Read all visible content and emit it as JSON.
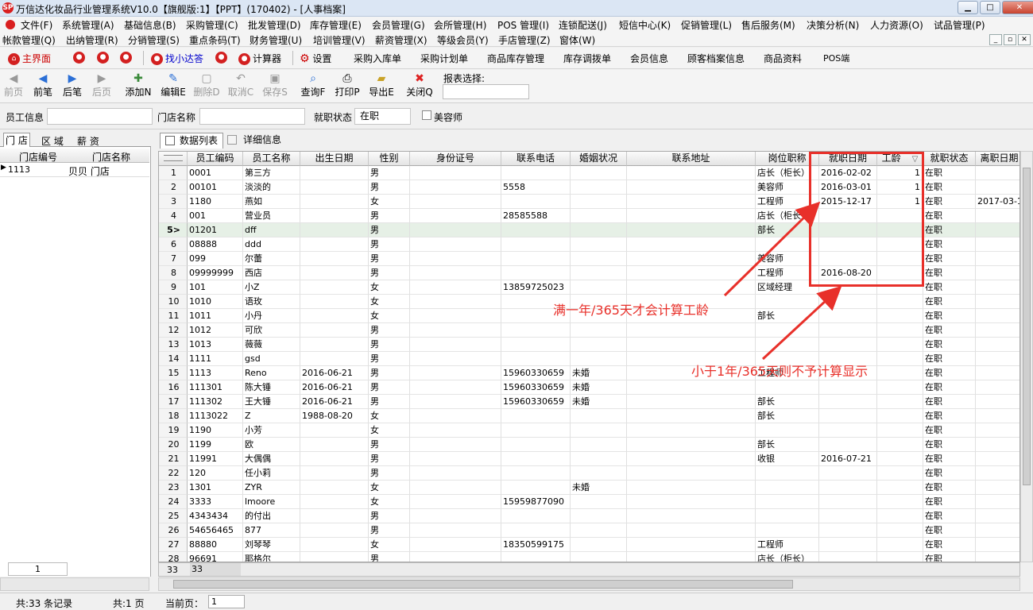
{
  "window": {
    "title": "万信达化妆品行业管理系统V10.0【旗舰版:1】【PPT】(170402) - [人事档案]",
    "logo": "SP",
    "min": "▁",
    "max": "□",
    "close": "✕"
  },
  "menu1": [
    "文件(F)",
    "系统管理(A)",
    "基础信息(B)",
    "采购管理(C)",
    "批发管理(D)",
    "库存管理(E)",
    "会员管理(G)",
    "会所管理(H)",
    "POS 管理(I)",
    "连锁配送(J)",
    "短信中心(K)",
    "促销管理(L)",
    "售后服务(M)",
    "决策分析(N)",
    "人力资源(O)",
    "试品管理(P)"
  ],
  "menu2": [
    "帐款管理(Q)",
    "出纳管理(R)",
    "分销管理(S)",
    "重点条码(T)",
    "财务管理(U)",
    "培训管理(V)",
    "薪资管理(X)",
    "等级会员(Y)",
    "手店管理(Z)",
    "窗体(W)"
  ],
  "mdi": [
    "_",
    "▫",
    "✕"
  ],
  "quickbar": {
    "home": "主界面",
    "find": "找小达答",
    "calculator": "计算器",
    "settings": "设置",
    "links": [
      "采购入库单",
      "采购计划单",
      "商品库存管理",
      "库存调拨单",
      "会员信息",
      "顾客档案信息",
      "商品资料",
      "POS端"
    ]
  },
  "toolbar": {
    "first": "前页",
    "prev": "前笔",
    "next": "后笔",
    "last": "后页",
    "add": "添加N",
    "edit": "编辑E",
    "delete": "删除D",
    "cancel": "取消C",
    "save": "保存S",
    "query": "查询F",
    "print": "打印P",
    "export": "导出E",
    "close": "关闭Q",
    "report_label": "报表选择:"
  },
  "filter": {
    "employee_label": "员工信息",
    "store_label": "门店名称",
    "status_label": "就职状态",
    "status_value": "在职",
    "beautician_label": "美容师"
  },
  "left": {
    "tabs": [
      "门 店",
      "区 域",
      "薪 资"
    ],
    "col_code": "门店编号",
    "col_name": "门店名称",
    "row_code": "1113",
    "row_name": "贝贝 门店",
    "footer_count": "1"
  },
  "right": {
    "tab_list": "数据列表",
    "tab_detail": "详细信息"
  },
  "grid": {
    "columns": [
      "员工编码",
      "员工名称",
      "出生日期",
      "性别",
      "身份证号",
      "联系电话",
      "婚姻状况",
      "联系地址",
      "岗位职称",
      "就职日期",
      "工龄",
      "就职状态",
      "离职日期"
    ],
    "sort_icon": "▽",
    "selected_index": 4,
    "rows": [
      [
        "1",
        "0001",
        "第三方",
        "",
        "男",
        "",
        "",
        "",
        "",
        "店长（柜长）",
        "2016-02-02",
        "1",
        "在职",
        ""
      ],
      [
        "2",
        "00101",
        "淡淡的",
        "",
        "男",
        "",
        "5558",
        "",
        "",
        "美容师",
        "2016-03-01",
        "1",
        "在职",
        ""
      ],
      [
        "3",
        "1180",
        "燕如",
        "",
        "女",
        "",
        "",
        "",
        "",
        "工程师",
        "2015-12-17",
        "1",
        "在职",
        "2017-03-1"
      ],
      [
        "4",
        "001",
        "营业员",
        "",
        "男",
        "",
        "28585588",
        "",
        "",
        "店长（柜长）",
        "",
        "",
        "在职",
        ""
      ],
      [
        "5>",
        "01201",
        "dff",
        "",
        "男",
        "",
        "",
        "",
        "",
        "部长",
        "",
        "",
        "在职",
        ""
      ],
      [
        "6",
        "08888",
        "ddd",
        "",
        "男",
        "",
        "",
        "",
        "",
        "",
        "",
        "",
        "在职",
        ""
      ],
      [
        "7",
        "099",
        "尔蕾",
        "",
        "男",
        "",
        "",
        "",
        "",
        "美容师",
        "",
        "",
        "在职",
        ""
      ],
      [
        "8",
        "09999999",
        "西店",
        "",
        "男",
        "",
        "",
        "",
        "",
        "工程师",
        "2016-08-20",
        "",
        "在职",
        ""
      ],
      [
        "9",
        "101",
        "小Z",
        "",
        "女",
        "",
        "13859725023",
        "",
        "",
        "区域经理",
        "",
        "",
        "在职",
        ""
      ],
      [
        "10",
        "1010",
        "语玫",
        "",
        "女",
        "",
        "",
        "",
        "",
        "",
        "",
        "",
        "在职",
        ""
      ],
      [
        "11",
        "1011",
        "小丹",
        "",
        "女",
        "",
        "",
        "",
        "",
        "部长",
        "",
        "",
        "在职",
        ""
      ],
      [
        "12",
        "1012",
        "可欣",
        "",
        "男",
        "",
        "",
        "",
        "",
        "",
        "",
        "",
        "在职",
        ""
      ],
      [
        "13",
        "1013",
        "薇薇",
        "",
        "男",
        "",
        "",
        "",
        "",
        "",
        "",
        "",
        "在职",
        ""
      ],
      [
        "14",
        "1111",
        "gsd",
        "",
        "男",
        "",
        "",
        "",
        "",
        "",
        "",
        "",
        "在职",
        ""
      ],
      [
        "15",
        "1113",
        "Reno",
        "2016-06-21",
        "男",
        "",
        "15960330659",
        "未婚",
        "",
        "工程师",
        "",
        "",
        "在职",
        ""
      ],
      [
        "16",
        "111301",
        "陈大锤",
        "2016-06-21",
        "男",
        "",
        "15960330659",
        "未婚",
        "",
        "",
        "",
        "",
        "在职",
        ""
      ],
      [
        "17",
        "111302",
        "王大锤",
        "2016-06-21",
        "男",
        "",
        "15960330659",
        "未婚",
        "",
        "部长",
        "",
        "",
        "在职",
        ""
      ],
      [
        "18",
        "1113022",
        "Z",
        "1988-08-20",
        "女",
        "",
        "",
        "",
        "",
        "部长",
        "",
        "",
        "在职",
        ""
      ],
      [
        "19",
        "1190",
        "小芳",
        "",
        "女",
        "",
        "",
        "",
        "",
        "",
        "",
        "",
        "在职",
        ""
      ],
      [
        "20",
        "1199",
        "欧",
        "",
        "男",
        "",
        "",
        "",
        "",
        "部长",
        "",
        "",
        "在职",
        ""
      ],
      [
        "21",
        "11991",
        "大偶偶",
        "",
        "男",
        "",
        "",
        "",
        "",
        "收银",
        "2016-07-21",
        "",
        "在职",
        ""
      ],
      [
        "22",
        "120",
        "任小莉",
        "",
        "男",
        "",
        "",
        "",
        "",
        "",
        "",
        "",
        "在职",
        ""
      ],
      [
        "23",
        "1301",
        "ZYR",
        "",
        "女",
        "",
        "",
        "未婚",
        "",
        "",
        "",
        "",
        "在职",
        ""
      ],
      [
        "24",
        "3333",
        "lmoore",
        "",
        "女",
        "",
        "15959877090",
        "",
        "",
        "",
        "",
        "",
        "在职",
        ""
      ],
      [
        "25",
        "4343434",
        "的付出",
        "",
        "男",
        "",
        "",
        "",
        "",
        "",
        "",
        "",
        "在职",
        ""
      ],
      [
        "26",
        "54656465",
        "877",
        "",
        "男",
        "",
        "",
        "",
        "",
        "",
        "",
        "",
        "在职",
        ""
      ],
      [
        "27",
        "88880",
        "刘琴琴",
        "",
        "女",
        "",
        "18350599175",
        "",
        "",
        "工程师",
        "",
        "",
        "在职",
        ""
      ],
      [
        "28",
        "96691",
        "耶格尔",
        "",
        "男",
        "",
        "",
        "",
        "",
        "店长（柜长）",
        "",
        "",
        "在职",
        ""
      ]
    ],
    "footer_count": "33",
    "footer_value": "33"
  },
  "annotations": {
    "note1": "满一年/365天才会计算工龄",
    "note2": "小于1年/365天则不予计算显示",
    "color": "#e8302a"
  },
  "status": {
    "records": "共:33 条记录",
    "pages": "共:1 页",
    "current_label": "当前页：",
    "current_value": "1"
  }
}
